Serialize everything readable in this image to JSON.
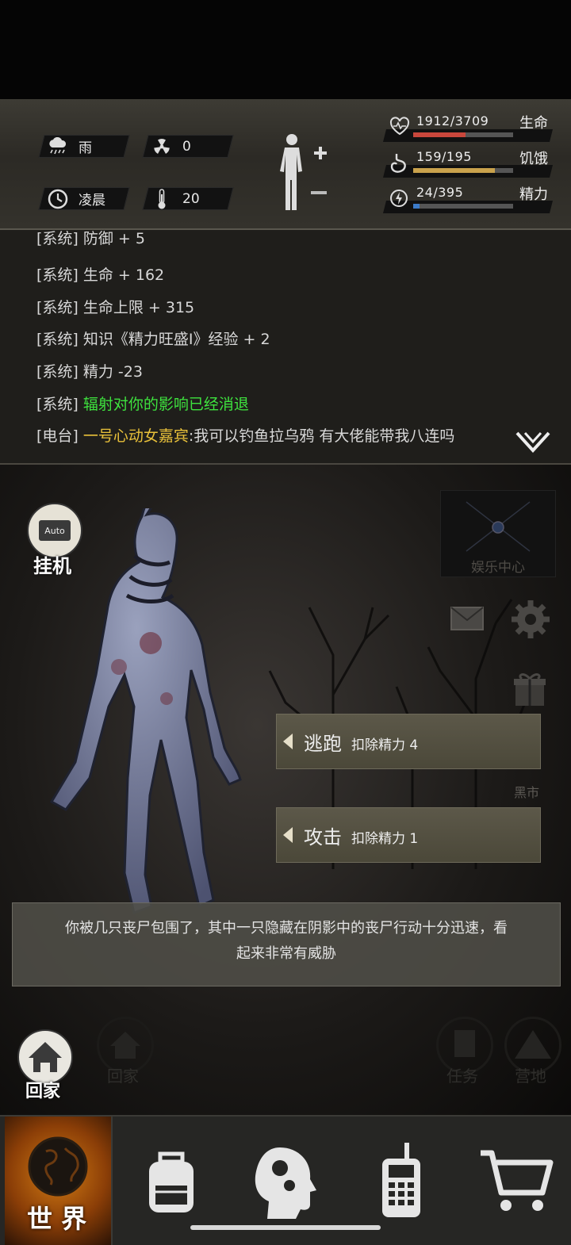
{
  "status": {
    "weather": "雨",
    "radiation": "0",
    "time_of_day": "凌晨",
    "temperature": "20",
    "stats": [
      {
        "id": "life",
        "value": "1912/3709",
        "label": "生命",
        "fill": 0.52,
        "color": "#c9473c"
      },
      {
        "id": "hunger",
        "value": "159/195",
        "label": "饥饿",
        "fill": 0.82,
        "color": "#c9a24c"
      },
      {
        "id": "energy",
        "value": "24/395",
        "label": "精力",
        "fill": 0.06,
        "color": "#3c7bc9"
      }
    ]
  },
  "log": [
    {
      "src": "[系统]",
      "msg": "防御 + 5",
      "style": "normal"
    },
    {
      "src": "[系统]",
      "msg": "生命 + 162",
      "style": "normal"
    },
    {
      "src": "[系统]",
      "msg": "生命上限 + 315",
      "style": "normal"
    },
    {
      "src": "[系统]",
      "msg": "知识《精力旺盛Ⅰ》经验 + 2",
      "style": "normal"
    },
    {
      "src": "[系统]",
      "msg": "精力 -23",
      "style": "normal"
    },
    {
      "src": "[系统]",
      "msg": "辐射对你的影响已经消退",
      "style": "green"
    },
    {
      "src": "[电台]",
      "speaker": "一号心动女嘉宾",
      "msg": ":我可以钓鱼拉乌鸦 有大佬能带我八连吗",
      "style": "radio"
    }
  ],
  "scene": {
    "auto_label": "挂机",
    "auto_badge": "Auto",
    "entertainment_label": "娱乐中心",
    "black_market_label": "黑市",
    "actions": [
      {
        "name": "逃跑",
        "cost": "扣除精力 4"
      },
      {
        "name": "攻击",
        "cost": "扣除精力 1"
      }
    ],
    "event_text": "你被几只丧尸包围了，其中一只隐藏在阴影中的丧尸行动十分迅速，看起来非常有威胁",
    "bg_labels": {
      "home_faded": "回家",
      "task": "任务",
      "camp": "营地"
    },
    "go_home_label": "回家"
  },
  "nav": {
    "world_label": "世 界"
  },
  "colors": {
    "green_msg": "#3ee23e",
    "radio_speaker": "#e8c03a",
    "world_glow": "#d27c14"
  }
}
